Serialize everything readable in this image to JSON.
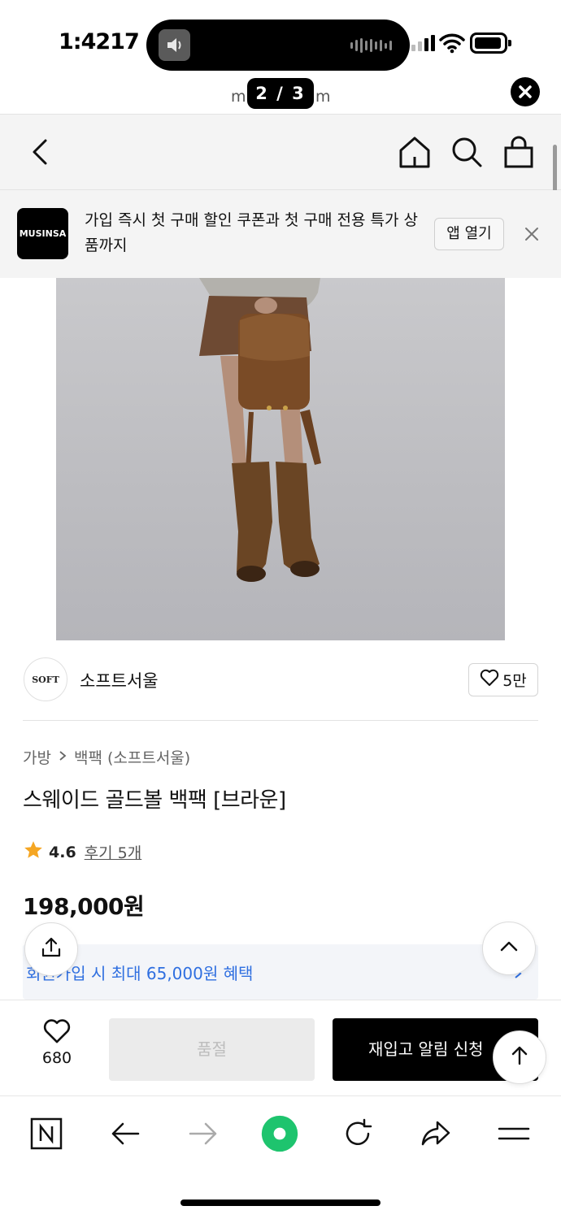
{
  "status_bar": {
    "time": "1:4217"
  },
  "url_fragments": {
    "left": "m",
    "right": "m"
  },
  "page_indicator": "2 / 3",
  "promo": {
    "logo_text": "MUSINSA",
    "text": "가입 즉시 첫 구매 할인 쿠폰과 첫 구매 전용 특가 상품까지",
    "button": "앱 열기"
  },
  "brand": {
    "logo_text": "SOFT",
    "name": "소프트서울",
    "likes": "5만"
  },
  "breadcrumb": {
    "category": "가방",
    "subcategory": "백팩 (소프트서울)"
  },
  "product": {
    "title": "스웨이드 골드볼 백팩 [브라운]",
    "rating": "4.6",
    "reviews": "후기 5개",
    "price": "198,000원"
  },
  "benefit": {
    "text": "회원가입 시 최대 65,000원 혜택"
  },
  "buy_bar": {
    "wish_count": "680",
    "soldout": "품절",
    "restock": "재입고 알림 신청"
  },
  "colors": {
    "accent_blue": "#2f6fe0",
    "star": "#f5a623",
    "brand_black": "#000000",
    "toolbar_green": "#1ec46e"
  },
  "icons": [
    "back-icon",
    "home-icon",
    "search-icon",
    "cart-icon",
    "close-icon",
    "heart-icon",
    "star-icon",
    "share-icon",
    "chevron-up-icon",
    "arrow-up-icon",
    "naver-n-icon",
    "arrow-left-icon",
    "arrow-right-icon",
    "refresh-icon",
    "forward-share-icon",
    "menu-icon"
  ]
}
